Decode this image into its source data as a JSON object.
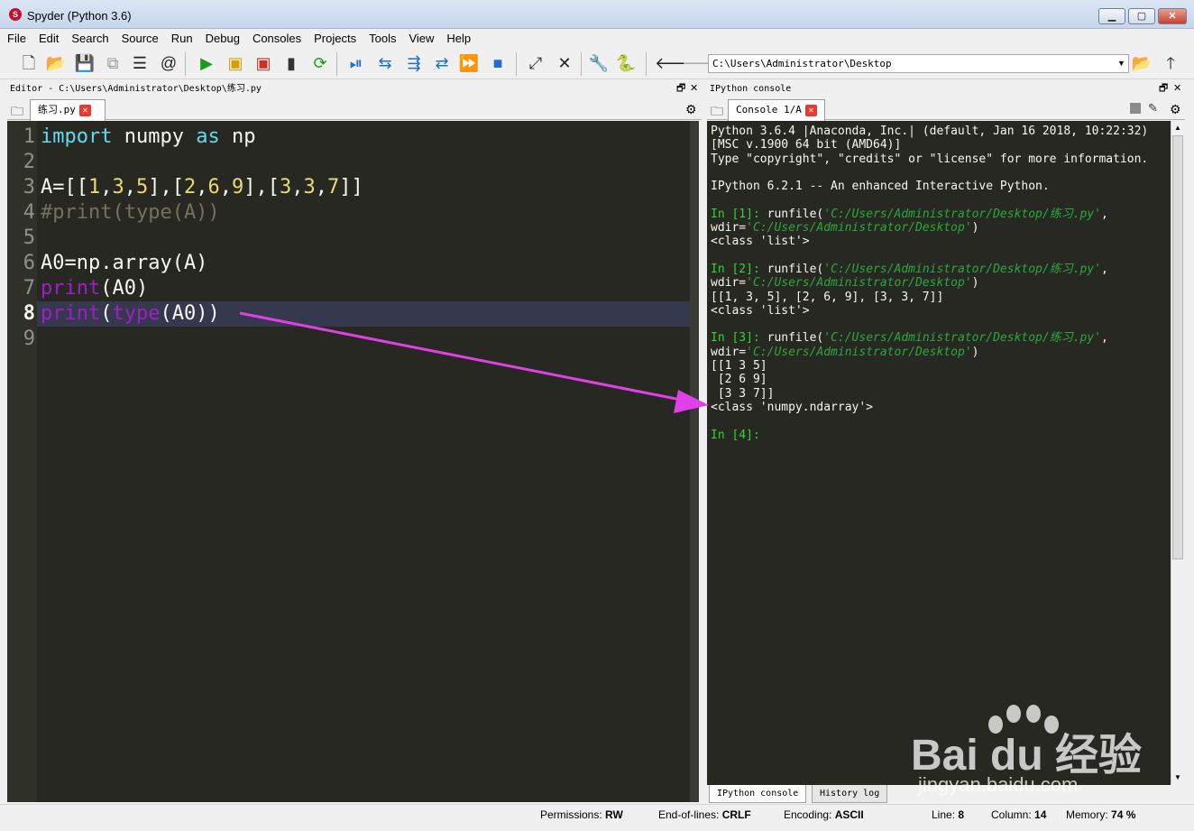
{
  "window": {
    "title": "Spyder (Python 3.6)",
    "minimize": "▁",
    "maximize": "▢",
    "close": "✕"
  },
  "menu": [
    "File",
    "Edit",
    "Search",
    "Source",
    "Run",
    "Debug",
    "Consoles",
    "Projects",
    "Tools",
    "View",
    "Help"
  ],
  "toolbar": {
    "working_dir": "C:\\Users\\Administrator\\Desktop"
  },
  "editor": {
    "pane_title": "Editor - C:\\Users\\Administrator\\Desktop\\练习.py",
    "tab_label": "练习.py",
    "current_line": 8,
    "line_numbers": [
      "1",
      "2",
      "3",
      "4",
      "5",
      "6",
      "7",
      "8",
      "9"
    ]
  },
  "console": {
    "pane_title": "IPython console",
    "tab_label": "Console 1/A",
    "bottom_tabs": [
      "IPython console",
      "History log"
    ]
  },
  "status": {
    "permissions_label": "Permissions:",
    "permissions_value": "RW",
    "eol_label": "End-of-lines:",
    "eol_value": "CRLF",
    "encoding_label": "Encoding:",
    "encoding_value": "ASCII",
    "line_label": "Line:",
    "line_value": "8",
    "column_label": "Column:",
    "column_value": "14",
    "memory_label": "Memory:",
    "memory_value": "74 %"
  },
  "watermark": {
    "brand": "Bai du 经验",
    "url": "jingyan.baidu.com"
  },
  "colors": {
    "editor_bg": "#272822",
    "keyword": "#66d9ef",
    "number": "#e6db74",
    "builtin": "#a01ec8",
    "prompt": "#31d431",
    "annotation_arrow": "#e040e8"
  }
}
